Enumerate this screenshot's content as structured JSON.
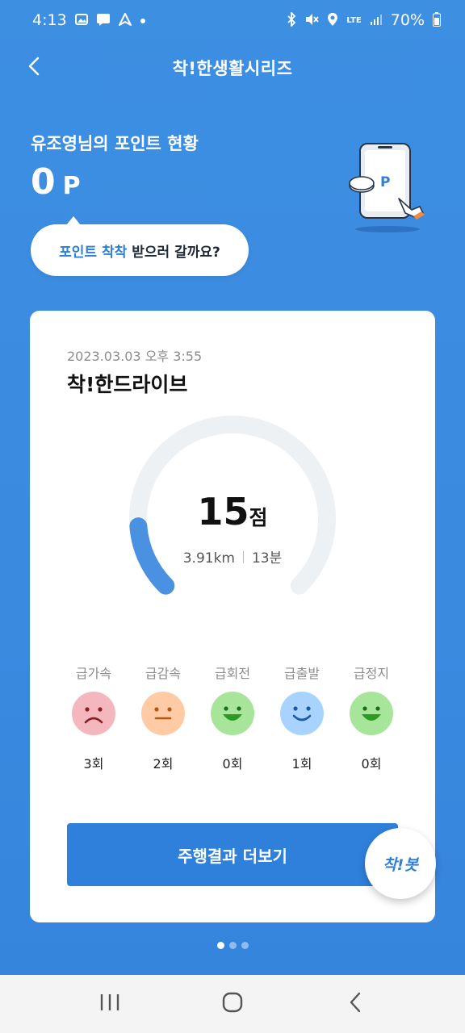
{
  "status": {
    "time": "4:13",
    "battery": "70%",
    "network": "LTE"
  },
  "header": {
    "title": "착!한생활시리즈"
  },
  "points": {
    "label": "유조영님의 포인트 현황",
    "value": "0",
    "unit": "P"
  },
  "bubble": {
    "highlight": "포인트 착착",
    "rest": "받으러 갈까요?"
  },
  "illustration": {
    "coin_label": "P"
  },
  "card": {
    "date": "2023.03.03 오후 3:55",
    "title": "착!한드라이브",
    "score": "15",
    "score_unit": "점",
    "score_fraction": 0.15,
    "distance": "3.91km",
    "duration": "13분",
    "behaviors": [
      {
        "label": "급가속",
        "count": "3회",
        "mood": "sad",
        "color": "#f3b7bd"
      },
      {
        "label": "급감속",
        "count": "2회",
        "mood": "neutral",
        "color": "#ffcba4"
      },
      {
        "label": "급회전",
        "count": "0회",
        "mood": "happy",
        "color": "#a6e59a"
      },
      {
        "label": "급출발",
        "count": "1회",
        "mood": "smile",
        "color": "#a9d3ff"
      },
      {
        "label": "급정지",
        "count": "0회",
        "mood": "happy",
        "color": "#a6e59a"
      }
    ],
    "more_button": "주행결과 더보기"
  },
  "fab": {
    "label": "착!봇"
  },
  "pager": {
    "total": 3,
    "active": 1
  },
  "colors": {
    "primary": "#2f80db",
    "accent": "#2f7fd6",
    "gauge_track": "#eef1f4",
    "gauge_fill": "#4a92e1"
  }
}
